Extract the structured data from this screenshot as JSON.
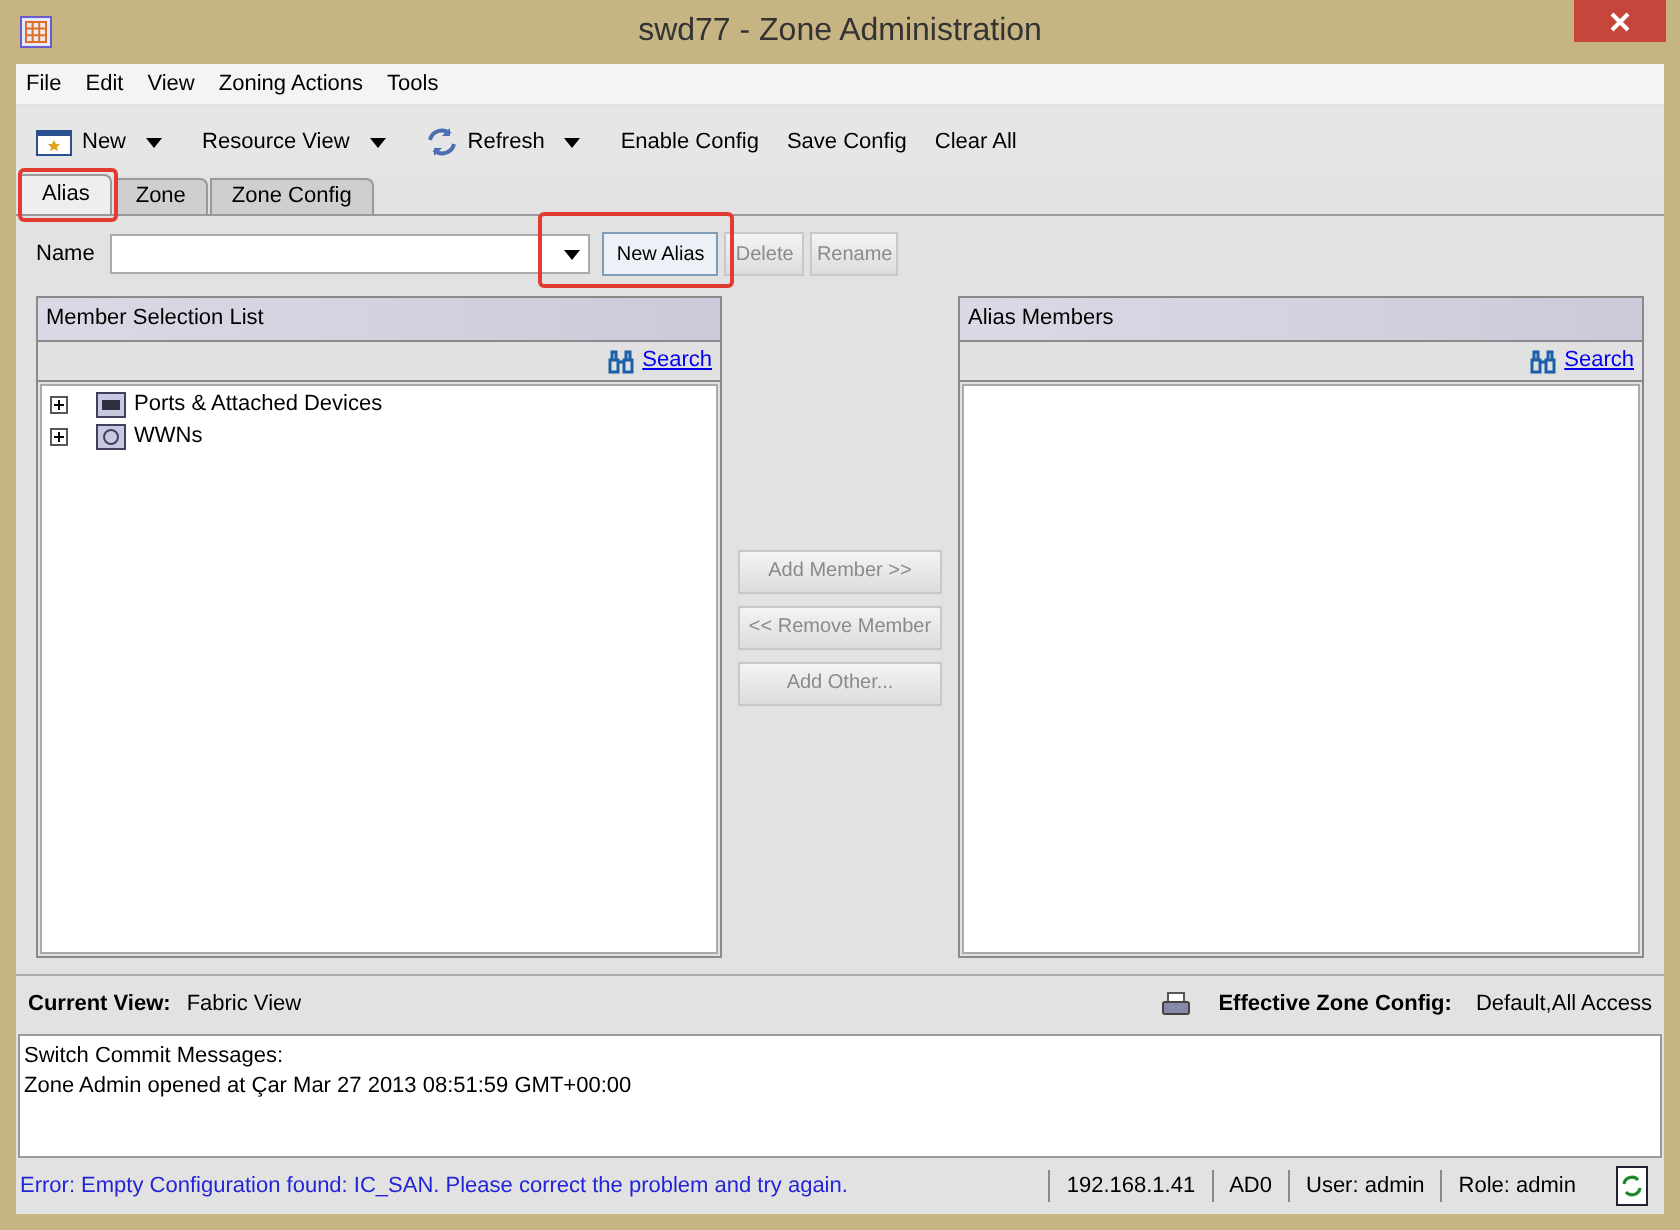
{
  "window": {
    "title": "swd77 - Zone Administration"
  },
  "menu": [
    "File",
    "Edit",
    "View",
    "Zoning Actions",
    "Tools"
  ],
  "toolbar": [
    {
      "label": "New",
      "kind": "new"
    },
    {
      "label": "Resource View",
      "kind": "dropdown"
    },
    {
      "label": "Refresh",
      "kind": "refresh"
    },
    {
      "label": "Enable Config",
      "kind": "plain"
    },
    {
      "label": "Save Config",
      "kind": "plain"
    },
    {
      "label": "Clear All",
      "kind": "plain"
    }
  ],
  "tabs": [
    {
      "label": "Alias",
      "selected": true
    },
    {
      "label": "Zone",
      "selected": false
    },
    {
      "label": "Zone Config",
      "selected": false
    }
  ],
  "name_field": {
    "label": "Name"
  },
  "name_buttons": [
    {
      "label": "New Alias",
      "disabled": false
    },
    {
      "label": "Delete",
      "disabled": true
    },
    {
      "label": "Rename",
      "disabled": true
    }
  ],
  "member_selection": {
    "title": "Member Selection List",
    "search": "Search",
    "tree": [
      {
        "label": "Ports & Attached Devices",
        "kind": "ports",
        "expanded": false
      },
      {
        "label": "WWNs",
        "kind": "wwn",
        "expanded": false
      }
    ]
  },
  "middle_buttons": [
    {
      "label": "Add Member >>",
      "disabled": true
    },
    {
      "label": "<< Remove Member",
      "disabled": true
    },
    {
      "label": "Add Other...",
      "disabled": true
    }
  ],
  "alias_members": {
    "title": "Alias Members",
    "search": "Search"
  },
  "view_bar": {
    "current_view_label": "Current View:",
    "current_view": "Fabric View",
    "effective_label": "Effective Zone Config:",
    "effective": "Default,All Access"
  },
  "messages": [
    "Switch Commit Messages:",
    "Zone Admin opened at Çar Mar 27 2013 08:51:59 GMT+00:00"
  ],
  "status_bar": {
    "error": "Error: Empty Configuration found: IC_SAN. Please correct the problem and try again.",
    "fields": [
      "192.168.1.41",
      "AD0",
      "User: admin",
      "Role: admin"
    ]
  }
}
